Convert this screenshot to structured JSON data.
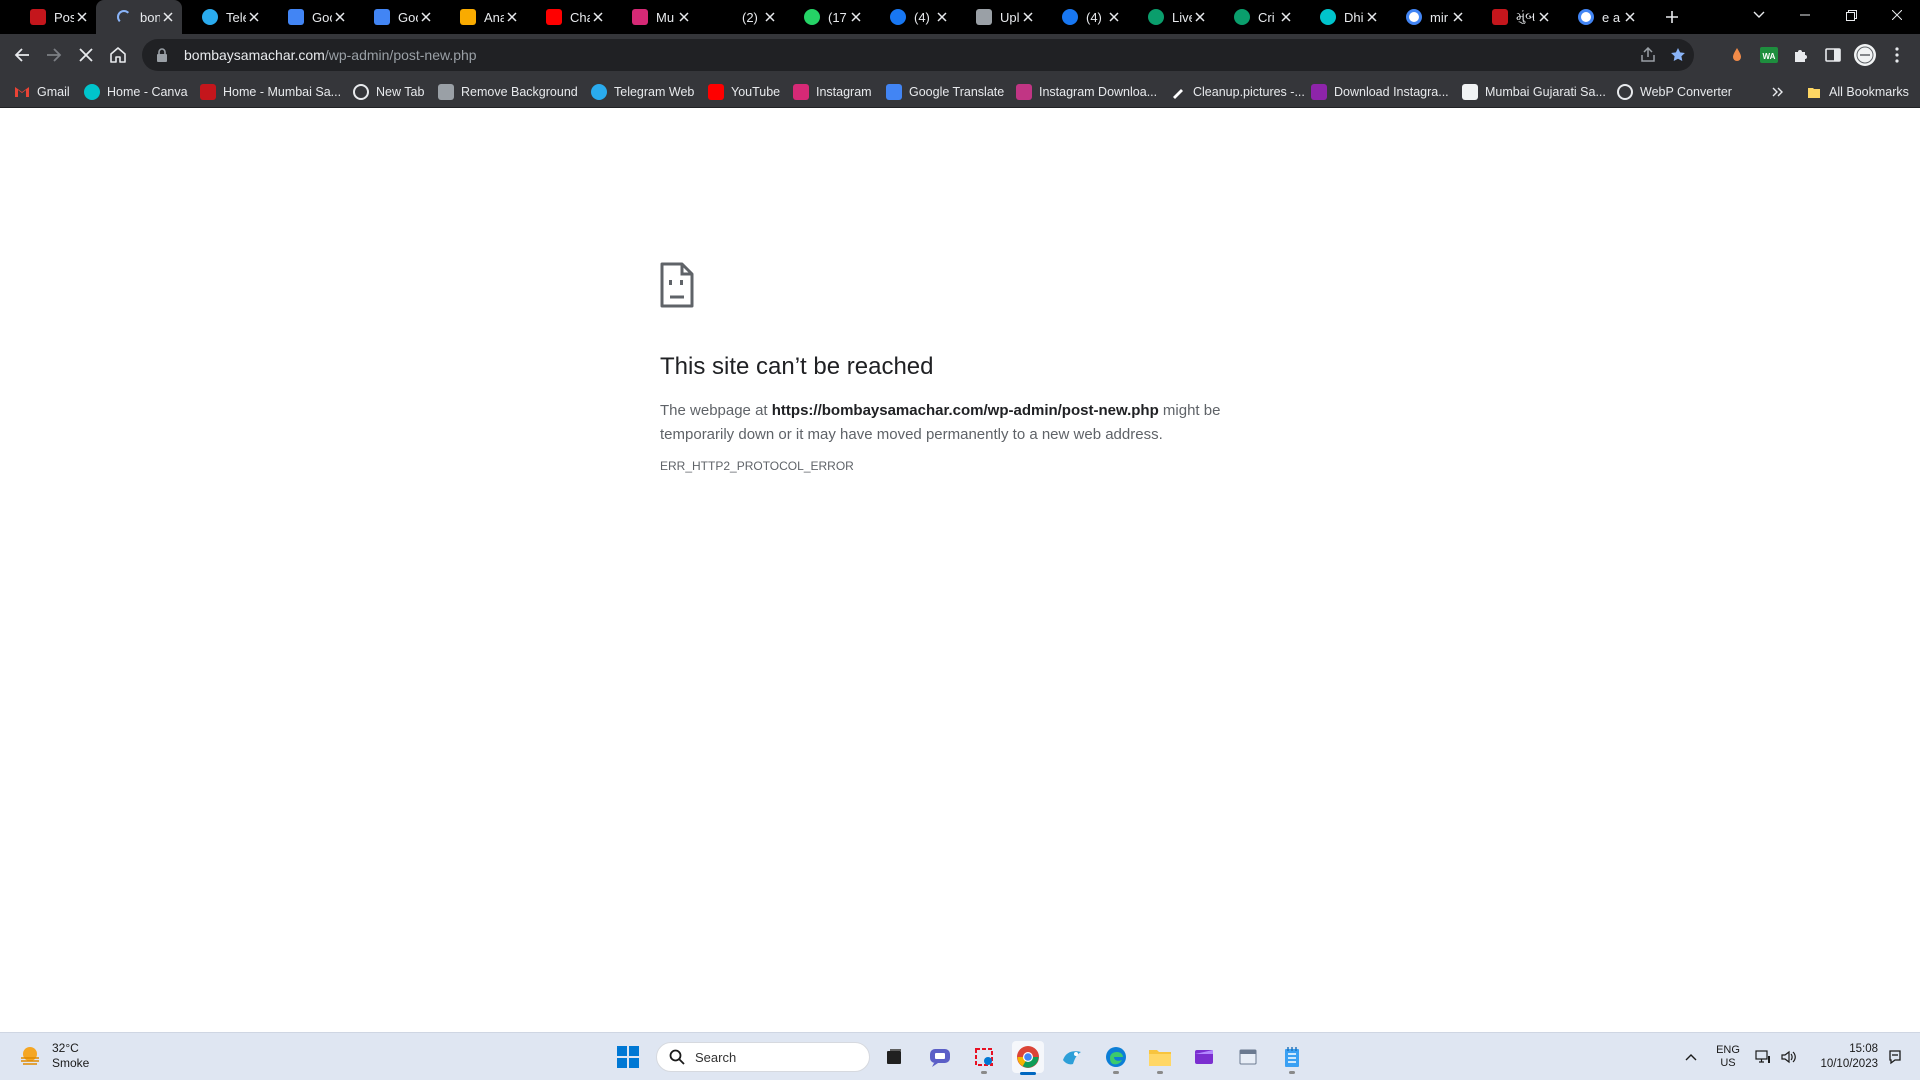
{
  "browser": {
    "tabs": [
      {
        "title": "Pos",
        "favicon": "bombay-samachar-favicon",
        "color": "#c4161c",
        "active": false
      },
      {
        "title": "bon",
        "favicon": "loading-spinner",
        "color": "#8ab4f8",
        "active": true
      },
      {
        "title": "Tele",
        "favicon": "telegram-icon",
        "color": "#2aabee",
        "active": false
      },
      {
        "title": "Goo",
        "favicon": "google-translate-icon",
        "color": "#4285f4",
        "active": false
      },
      {
        "title": "Goo",
        "favicon": "google-translate-icon",
        "color": "#4285f4",
        "active": false
      },
      {
        "title": "Ana",
        "favicon": "analytics-icon",
        "color": "#f9ab00",
        "active": false
      },
      {
        "title": "Cha",
        "favicon": "youtube-icon",
        "color": "#ff0000",
        "active": false
      },
      {
        "title": "Mu",
        "favicon": "instagram-icon",
        "color": "#d62976",
        "active": false
      },
      {
        "title": "(2)",
        "favicon": "x-icon",
        "color": "#000000",
        "active": false
      },
      {
        "title": "(17",
        "favicon": "whatsapp-icon",
        "color": "#25d366",
        "active": false
      },
      {
        "title": "(4)",
        "favicon": "facebook-icon",
        "color": "#1877f2",
        "active": false
      },
      {
        "title": "Upl",
        "favicon": "remove-bg-icon",
        "color": "#9aa0a6",
        "active": false
      },
      {
        "title": "(4)",
        "favicon": "facebook-icon",
        "color": "#1877f2",
        "active": false
      },
      {
        "title": "Live",
        "favicon": "cricbuzz-icon",
        "color": "#0a9e6c",
        "active": false
      },
      {
        "title": "Cri",
        "favicon": "cricbuzz-icon",
        "color": "#0a9e6c",
        "active": false
      },
      {
        "title": "Dhi",
        "favicon": "canva-icon",
        "color": "#00c4cc",
        "active": false
      },
      {
        "title": "mir",
        "favicon": "google-icon",
        "color": "#ffffff",
        "active": false
      },
      {
        "title": "મુંબ",
        "favicon": "bombay-samachar-favicon",
        "color": "#c4161c",
        "active": false
      },
      {
        "title": "e a",
        "favicon": "google-icon",
        "color": "#ffffff",
        "active": false
      }
    ],
    "address": {
      "host": "bombaysamachar.com",
      "path": "/wp-admin/post-new.php"
    },
    "bookmarks": [
      {
        "label": "Gmail",
        "icon": "gmail-icon",
        "color": "#ea4335"
      },
      {
        "label": "Home - Canva",
        "icon": "canva-icon",
        "color": "#00c4cc"
      },
      {
        "label": "Home - Mumbai Sa...",
        "icon": "bombay-samachar-favicon",
        "color": "#c4161c"
      },
      {
        "label": "New Tab",
        "icon": "chrome-icon",
        "color": "#e8eaed"
      },
      {
        "label": "Remove Background",
        "icon": "remove-bg-icon",
        "color": "#9aa0a6"
      },
      {
        "label": "Telegram Web",
        "icon": "telegram-icon",
        "color": "#2aabee"
      },
      {
        "label": "YouTube",
        "icon": "youtube-icon",
        "color": "#ff0000"
      },
      {
        "label": "Instagram",
        "icon": "instagram-icon",
        "color": "#d62976"
      },
      {
        "label": "Google Translate",
        "icon": "google-translate-icon",
        "color": "#4285f4"
      },
      {
        "label": "Instagram Downloa...",
        "icon": "instagram-download-icon",
        "color": "#c13584"
      },
      {
        "label": "Cleanup.pictures -...",
        "icon": "cleanup-icon",
        "color": "#ffffff"
      },
      {
        "label": "Download Instagra...",
        "icon": "download-icon",
        "color": "#8e24aa"
      },
      {
        "label": "Mumbai Gujarati Sa...",
        "icon": "page-icon",
        "color": "#e8eaed"
      },
      {
        "label": "WebP Converter",
        "icon": "chrome-icon",
        "color": "#e8eaed"
      }
    ],
    "all_bookmarks_label": "All Bookmarks"
  },
  "error": {
    "title": "This site can’t be reached",
    "desc_before": "The webpage at ",
    "desc_url": "https://bombaysamachar.com/wp-admin/post-new.php",
    "desc_after": " might be temporarily down or it may have moved permanently to a new web address.",
    "code": "ERR_HTTP2_PROTOCOL_ERROR"
  },
  "taskbar": {
    "weather_temp": "32°C",
    "weather_desc": "Smoke",
    "search_placeholder": "Search",
    "lang_top": "ENG",
    "lang_bottom": "US",
    "time": "15:08",
    "date": "10/10/2023"
  },
  "colors": {
    "accent_blue": "#8ab4f8",
    "star_blue": "#8ab4f8",
    "taskbar_indicator": "#0067c0"
  }
}
